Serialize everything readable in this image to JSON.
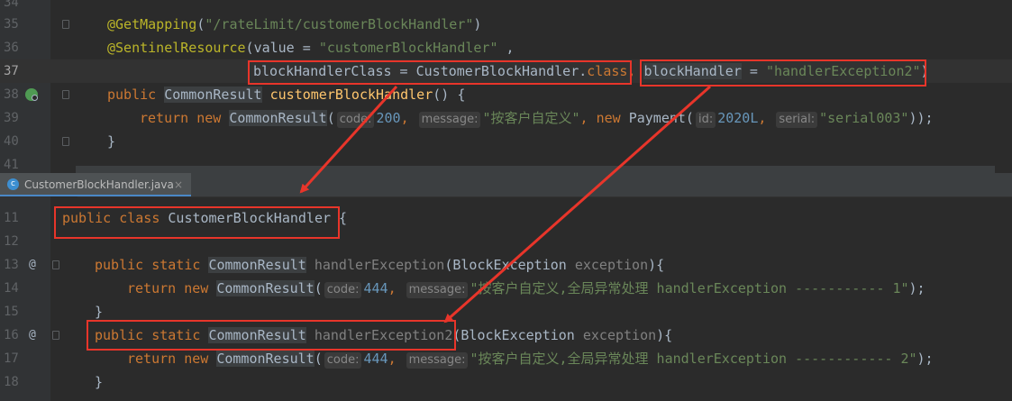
{
  "top_editor": {
    "lines": [
      {
        "num": "34"
      },
      {
        "num": "35",
        "annotation": "@GetMapping",
        "paren_open": "(",
        "path": "\"/rateLimit/customerBlockHandler\"",
        "paren_close": ")"
      },
      {
        "num": "36",
        "annotation": "@SentinelResource",
        "paren_open": "(",
        "value_key": "value = ",
        "value": "\"customerBlockHandler\"",
        "comma": " ,"
      },
      {
        "num": "37",
        "class_param": "blockHandlerClass = CustomerBlockHandler.",
        "class_kw": "class",
        "comma": ",",
        "handler_key": "blockHandler",
        "eq": " = ",
        "handler_val": "\"handlerException2\"",
        "paren_close": ")"
      },
      {
        "num": "38",
        "kw_public": "public ",
        "ret_type": "CommonResult",
        "method": "customerBlockHandler",
        "sig_end": "() {"
      },
      {
        "num": "39",
        "kw_return": "return new ",
        "ctor": "CommonResult",
        "paren": "(",
        "hint_code": "code:",
        "code_val": "200",
        "comma1": ", ",
        "hint_msg": "message:",
        "msg_val": "\"按客户自定义\"",
        "comma2": ", ",
        "kw_new": "new ",
        "payment": "Payment(",
        "hint_id": "id:",
        "id_val": "2020L",
        "comma3": ", ",
        "hint_serial": "serial:",
        "serial_val": "\"serial003\"",
        "end": "));"
      },
      {
        "num": "40",
        "brace": "}"
      },
      {
        "num": "41"
      }
    ]
  },
  "tab": {
    "icon_letter": "c",
    "label": "CustomerBlockHandler.java",
    "close": "×"
  },
  "bottom_editor": {
    "lines": [
      {
        "num": "11",
        "kw": "public class ",
        "cls": "CustomerBlockHandler",
        "brace": " {"
      },
      {
        "num": "12"
      },
      {
        "num": "13",
        "kw": "public static ",
        "ret_type": "CommonResult",
        "method": "handlerException",
        "param_open": "(",
        "param_type": "BlockException ",
        "param": "exception",
        "sig_end": "){"
      },
      {
        "num": "14",
        "kw_return": "return new ",
        "ctor": "CommonResult",
        "paren": "(",
        "hint_code": "code:",
        "code_val": "444",
        "comma1": ", ",
        "hint_msg": "message:",
        "msg_val": "\"按客户自定义,全局异常处理 handlerException ----------- 1\"",
        "end": ");"
      },
      {
        "num": "15",
        "brace": "}"
      },
      {
        "num": "16",
        "kw": "public static ",
        "ret_type": "CommonResult",
        "method": "handlerException2",
        "param_open": "(",
        "param_type": "BlockException ",
        "param": "exception",
        "sig_end": "){"
      },
      {
        "num": "17",
        "kw_return": "return new ",
        "ctor": "CommonResult",
        "paren": "(",
        "hint_code": "code:",
        "code_val": "444",
        "comma1": ", ",
        "hint_msg": "message:",
        "msg_val": "\"按客户自定义,全局异常处理 handlerException ------------ 2\"",
        "end": ");"
      },
      {
        "num": "18",
        "brace": "}"
      }
    ]
  },
  "colors": {
    "highlight_box": "#e8352a",
    "arrow": "#e8352a",
    "background": "#2b2b2b"
  },
  "icons": {
    "gutter_at": "override-icon",
    "gutter_run": "run-endpoint-icon",
    "tab_icon": "java-class-icon"
  }
}
